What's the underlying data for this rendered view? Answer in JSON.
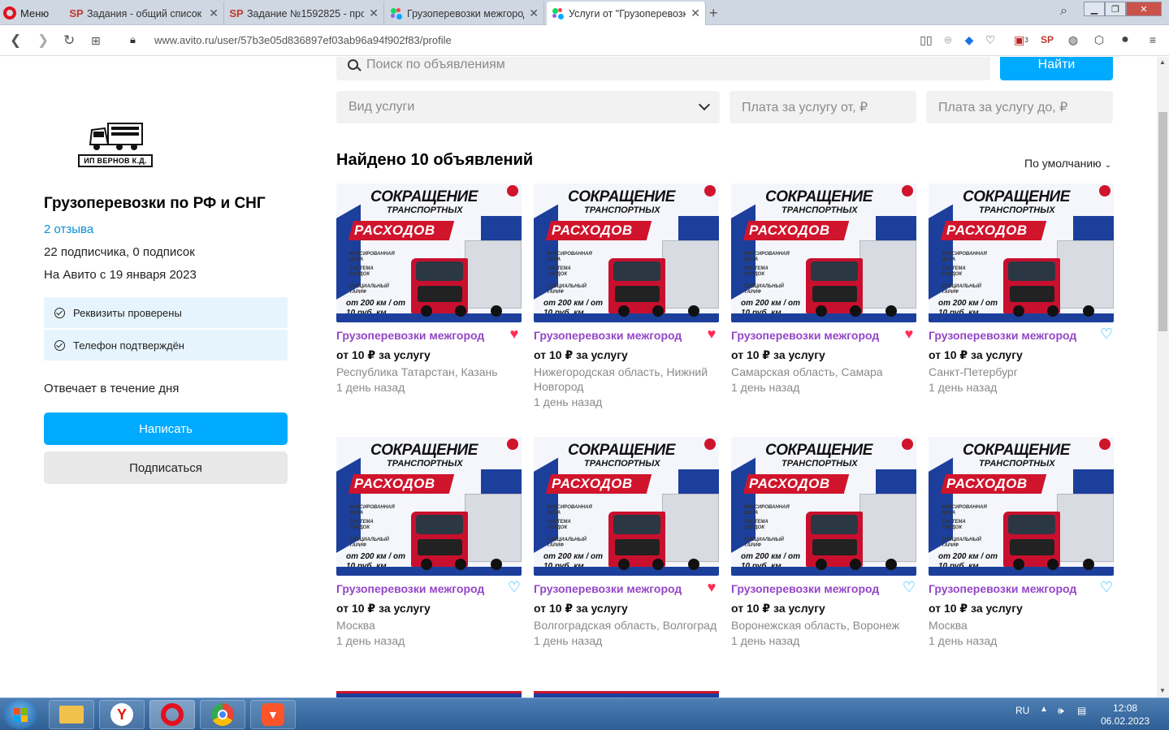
{
  "browser": {
    "menu_label": "Меню",
    "tabs": [
      {
        "label": "Задания - общий список з",
        "icon": "sp-icon"
      },
      {
        "label": "Задание №1592825 - прос",
        "icon": "sp-icon"
      },
      {
        "label": "Грузоперевозки межгород",
        "icon": "avito-icon"
      },
      {
        "label": "Услуги от \"Грузоперевозк",
        "icon": "avito-icon"
      }
    ],
    "url": "www.avito.ru/user/57b3e05d836897ef03ab96a94f902f83/profile",
    "ext_badge_1": "3"
  },
  "seller": {
    "logo_text": "ИП  ВЕРНОВ К.Д.",
    "name": "Грузоперевозки по РФ и СНГ",
    "reviews": "2 отзыва",
    "subscribers": "22 подписчика, 0 подписок",
    "since": "На Авито с 19 января 2023",
    "verifications": [
      "Реквизиты проверены",
      "Телефон подтверждён"
    ],
    "responds": "Отвечает в течение дня",
    "write_button": "Написать",
    "subscribe_button": "Подписаться"
  },
  "search": {
    "placeholder": "Поиск по объявлениям",
    "find_button": "Найти",
    "service_type": "Вид услуги",
    "price_from": "Плата за услугу от, ₽",
    "price_to": "Плата за услугу до, ₽"
  },
  "results": {
    "found": "Найдено 10 объявлений",
    "sort": "По умолчанию"
  },
  "ad_image": {
    "line1": "СОКРАЩЕНИЕ",
    "line2": "ТРАНСПОРТНЫХ",
    "line3": "РАСХОДОВ",
    "f1": "ФИКСИРОВАННАЯ ЦЕНА",
    "f2": "СИСТЕМА СКИДОК",
    "f3": "СПЕЦИАЛЬНЫЙ ТАРИФ",
    "promo": "от 200 км / от 10 руб. км"
  },
  "listings": [
    {
      "title": "Грузоперевозки межгород",
      "price": "от 10 ₽ за услугу",
      "location": "Республика Татарстан, Казань",
      "time": "1 день назад",
      "favorite": true
    },
    {
      "title": "Грузоперевозки межгород",
      "price": "от 10 ₽ за услугу",
      "location": "Нижегородская область, Нижний Новгород",
      "time": "1 день назад",
      "favorite": true
    },
    {
      "title": "Грузоперевозки межгород",
      "price": "от 10 ₽ за услугу",
      "location": "Самарская область, Самара",
      "time": "1 день назад",
      "favorite": true
    },
    {
      "title": "Грузоперевозки межгород",
      "price": "от 10 ₽ за услугу",
      "location": "Санкт-Петербург",
      "time": "1 день назад",
      "favorite": false
    },
    {
      "title": "Грузоперевозки межгород",
      "price": "от 10 ₽ за услугу",
      "location": "Москва",
      "time": "1 день назад",
      "favorite": false
    },
    {
      "title": "Грузоперевозки межгород",
      "price": "от 10 ₽ за услугу",
      "location": "Волгоградская область, Волгоград",
      "time": "1 день назад",
      "favorite": true
    },
    {
      "title": "Грузоперевозки межгород",
      "price": "от 10 ₽ за услугу",
      "location": "Воронежская область, Воронеж",
      "time": "1 день назад",
      "favorite": false
    },
    {
      "title": "Грузоперевозки межгород",
      "price": "от 10 ₽ за услугу",
      "location": "Москва",
      "time": "1 день назад",
      "favorite": false
    }
  ],
  "taskbar": {
    "lang": "RU",
    "time": "12:08",
    "date": "06.02.2023"
  },
  "colors": {
    "accent": "#00aaff",
    "title_purple": "#9446c7",
    "heart_red": "#ff2d55"
  }
}
